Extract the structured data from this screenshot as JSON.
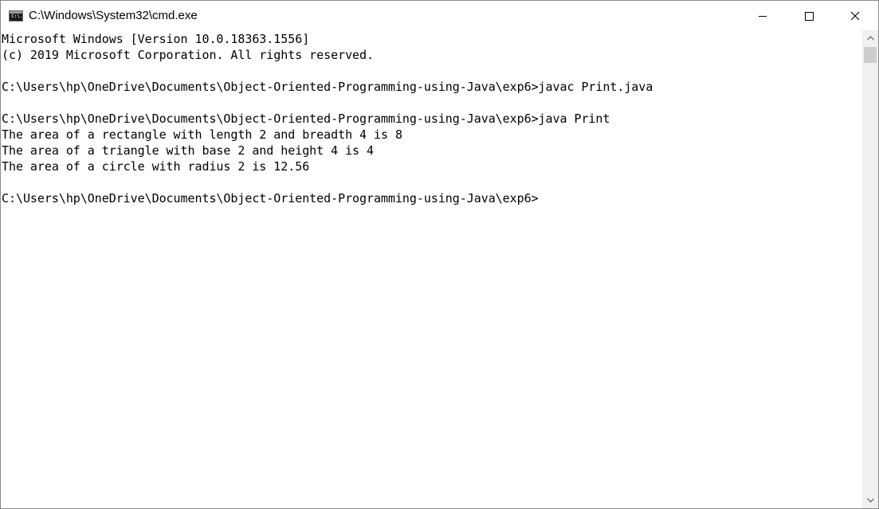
{
  "window": {
    "title": "C:\\Windows\\System32\\cmd.exe",
    "app_icon_text": "C:\\."
  },
  "controls": {
    "minimize_icon": "minimize-icon",
    "maximize_icon": "maximize-icon",
    "close_icon": "close-icon"
  },
  "console": {
    "lines": [
      "Microsoft Windows [Version 10.0.18363.1556]",
      "(c) 2019 Microsoft Corporation. All rights reserved.",
      "",
      "C:\\Users\\hp\\OneDrive\\Documents\\Object-Oriented-Programming-using-Java\\exp6>javac Print.java",
      "",
      "C:\\Users\\hp\\OneDrive\\Documents\\Object-Oriented-Programming-using-Java\\exp6>java Print",
      "The area of a rectangle with length 2 and breadth 4 is 8",
      "The area of a triangle with base 2 and height 4 is 4",
      "The area of a circle with radius 2 is 12.56",
      "",
      "C:\\Users\\hp\\OneDrive\\Documents\\Object-Oriented-Programming-using-Java\\exp6>"
    ]
  },
  "scrollbar": {
    "up_icon": "scroll-up-icon",
    "down_icon": "scroll-down-icon"
  }
}
